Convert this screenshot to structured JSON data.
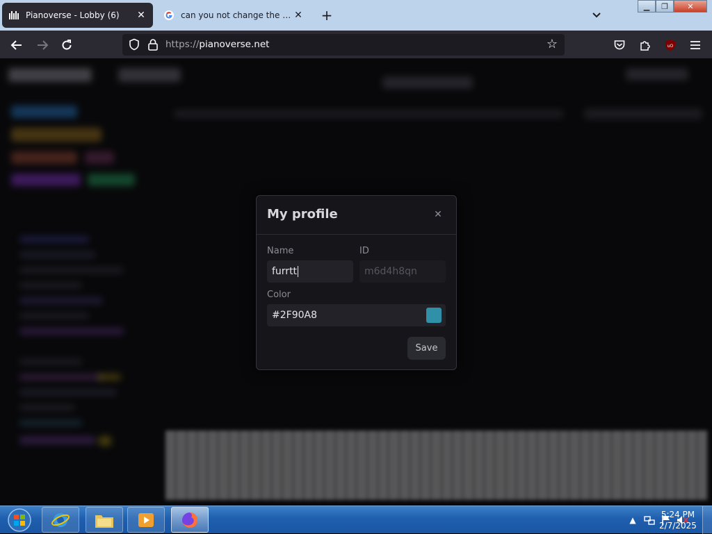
{
  "browser": {
    "tabs": [
      {
        "title": "Pianoverse - Lobby (6)",
        "active": true,
        "icon": "pianoverse-logo-icon"
      },
      {
        "title": "can you not change the name - Google Search",
        "active": false,
        "icon": "google-icon"
      }
    ],
    "url_scheme": "https://",
    "url_host": "pianoverse.net"
  },
  "modal": {
    "title": "My profile",
    "name_label": "Name",
    "name_value": "furrtt",
    "id_label": "ID",
    "id_placeholder": "m6d4h8qn",
    "color_label": "Color",
    "color_value": "#2F90A8",
    "save_label": "Save"
  },
  "taskbar": {
    "time": "5:24 PM",
    "date": "2/7/2025"
  },
  "colors": {
    "profile_color": "#2F90A8",
    "active_tab_bg": "#2b2a33",
    "modal_bg": "#16161a"
  }
}
